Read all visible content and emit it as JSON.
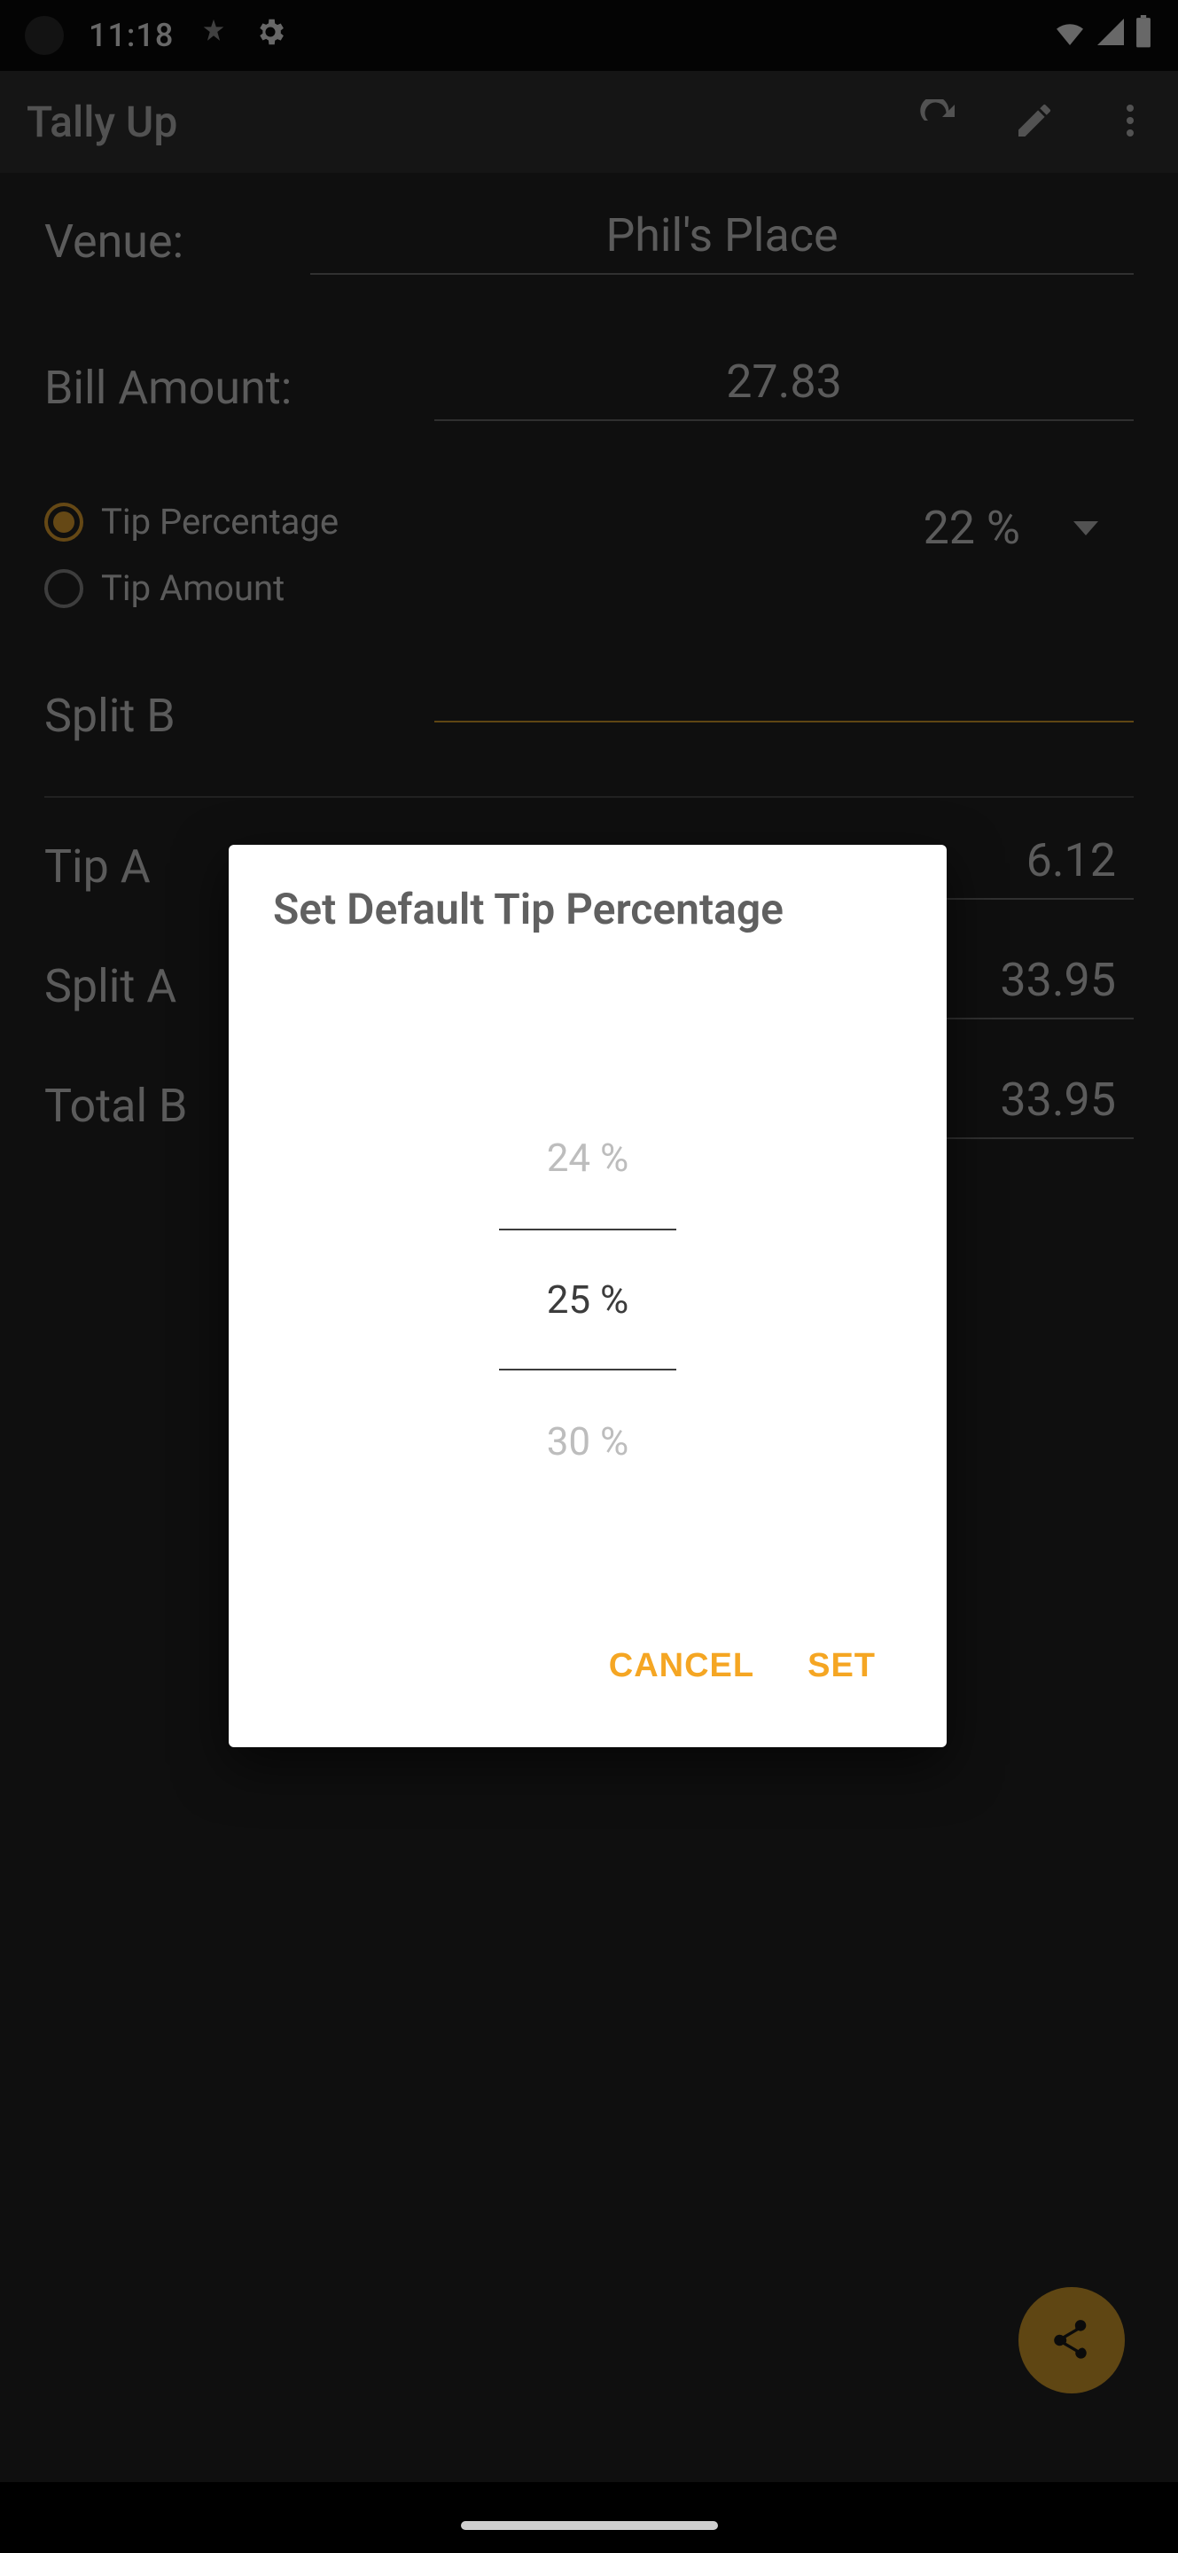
{
  "status_bar": {
    "time": "11:18",
    "icons": [
      "location-icon",
      "settings-gear-icon",
      "wifi-icon",
      "cell-signal-icon",
      "battery-icon"
    ]
  },
  "app_bar": {
    "title": "Tally Up",
    "actions": {
      "refresh": "refresh-icon",
      "edit": "pencil-icon",
      "overflow": "more-vert-icon"
    }
  },
  "form": {
    "venue_label": "Venue:",
    "venue_value": "Phil's Place",
    "bill_label": "Bill Amount:",
    "bill_value": "27.83",
    "tip_mode": {
      "percentage_label": "Tip Percentage",
      "amount_label": "Tip Amount",
      "selected": "percentage"
    },
    "tip_percentage_value": "22 %",
    "split_by_label": "Split B",
    "tip_amount_label": "Tip A",
    "tip_amount_value": "6.12",
    "split_amount_label": "Split A",
    "split_amount_value": "33.95",
    "total_label": "Total B",
    "total_value": "33.95"
  },
  "fab": {
    "icon": "share-icon"
  },
  "dialog": {
    "title": "Set Default Tip Percentage",
    "options": {
      "prev": "24 %",
      "selected": "25 %",
      "next": "30 %"
    },
    "buttons": {
      "cancel": "CANCEL",
      "set": "SET"
    }
  },
  "colors": {
    "accent": "#f5a623",
    "fab": "#d29b2a"
  }
}
